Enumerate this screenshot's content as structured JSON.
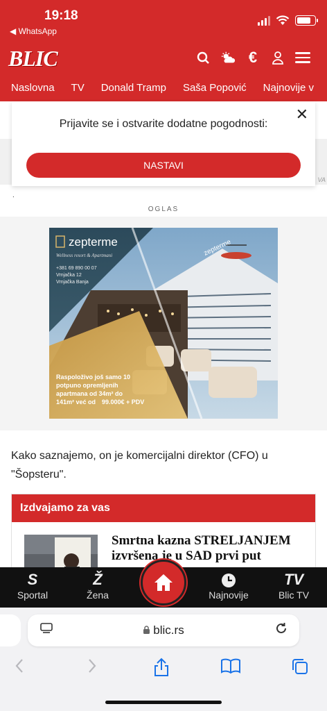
{
  "status": {
    "time": "19:18",
    "back_app": "◀ WhatsApp"
  },
  "header": {
    "logo": "BLIC",
    "nav": [
      "Naslovna",
      "TV",
      "Donald Tramp",
      "Saša Popović",
      "Najnovije v"
    ]
  },
  "prompt": {
    "text": "Prijavite se i ostvarite dodatne pogodnosti:",
    "button": "NASTAVI",
    "close": "✕",
    "side_right": "VA"
  },
  "ad": {
    "label": "OGLAS",
    "brand": "zepterme",
    "tagline": "Wellness resort & Apartmani",
    "phone": "+381 69 890 00 07",
    "street": "Vrnjačka 12",
    "city": "Vrnjačka Banja",
    "copy_1": "Raspoloživo još samo 10",
    "copy_2": "potpuno opremljenih",
    "copy_3": "apartmana od 34m² do",
    "copy_4": "141m² već od",
    "copy_price": "99.000€ + PDV"
  },
  "article": {
    "text": "Kako saznajemo, on je komercijalni direktor (CFO) u \"Šopsteru\"."
  },
  "featured": {
    "heading": "Izdvajamo za vas",
    "title": "Smrtna kazna STRELJANJEM izvršena je u SAD prvi put"
  },
  "bottom_nav": {
    "items": [
      {
        "icon": "S",
        "label": "Sportal"
      },
      {
        "icon": "Ž",
        "label": "Žena"
      },
      {
        "icon": "",
        "label": "Najnovije"
      },
      {
        "icon": "TV",
        "label": "Blic TV"
      }
    ]
  },
  "browser": {
    "url": "blic.rs"
  },
  "colors": {
    "brand_red": "#d32a2a",
    "nav_dark": "#111111",
    "safari_blue": "#1a73e8"
  }
}
